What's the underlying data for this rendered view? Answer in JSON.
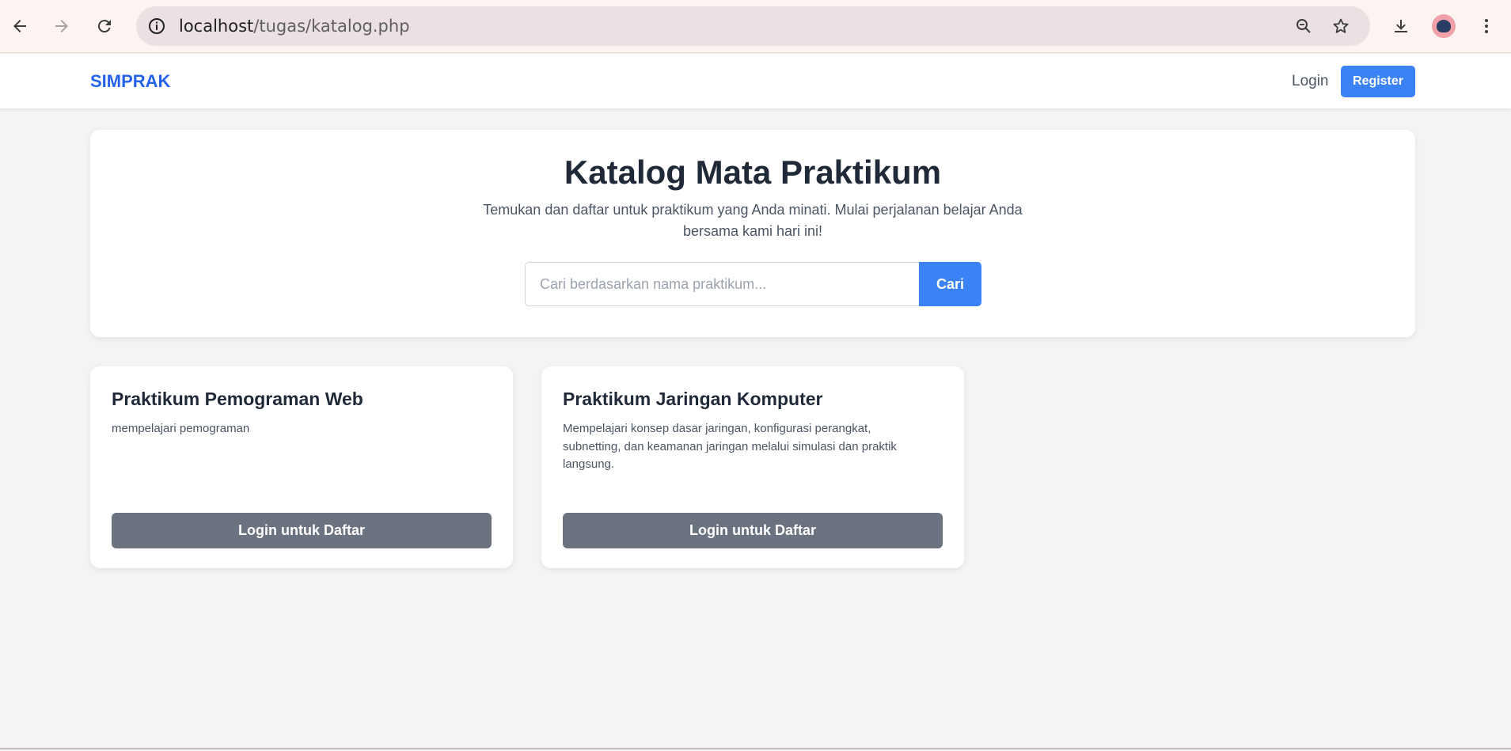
{
  "browser": {
    "url_host": "localhost",
    "url_path": "/tugas/katalog.php",
    "icons": [
      "back-arrow-icon",
      "forward-arrow-icon",
      "reload-icon",
      "info-icon",
      "zoom-icon",
      "star-icon",
      "download-icon",
      "profile-avatar",
      "menu-dots-icon"
    ]
  },
  "nav": {
    "brand": "SIMPRAK",
    "login_label": "Login",
    "register_label": "Register"
  },
  "hero": {
    "title": "Katalog Mata Praktikum",
    "subtitle": "Temukan dan daftar untuk praktikum yang Anda minati. Mulai perjalanan belajar Anda bersama kami hari ini!",
    "search_placeholder": "Cari berdasarkan nama praktikum...",
    "search_value": "",
    "search_button": "Cari"
  },
  "courses": [
    {
      "title": "Praktikum Pemograman Web",
      "description": "mempelajari pemograman",
      "button": "Login untuk Daftar"
    },
    {
      "title": "Praktikum Jaringan Komputer",
      "description": "Mempelajari konsep dasar jaringan, konfigurasi perangkat, subnetting, dan keamanan jaringan melalui simulasi dan praktik langsung.",
      "button": "Login untuk Daftar"
    }
  ],
  "colors": {
    "brand": "#2563eb",
    "primary_button": "#3b82f6",
    "secondary_button": "#6b7280",
    "page_background": "#f3f4f6"
  }
}
